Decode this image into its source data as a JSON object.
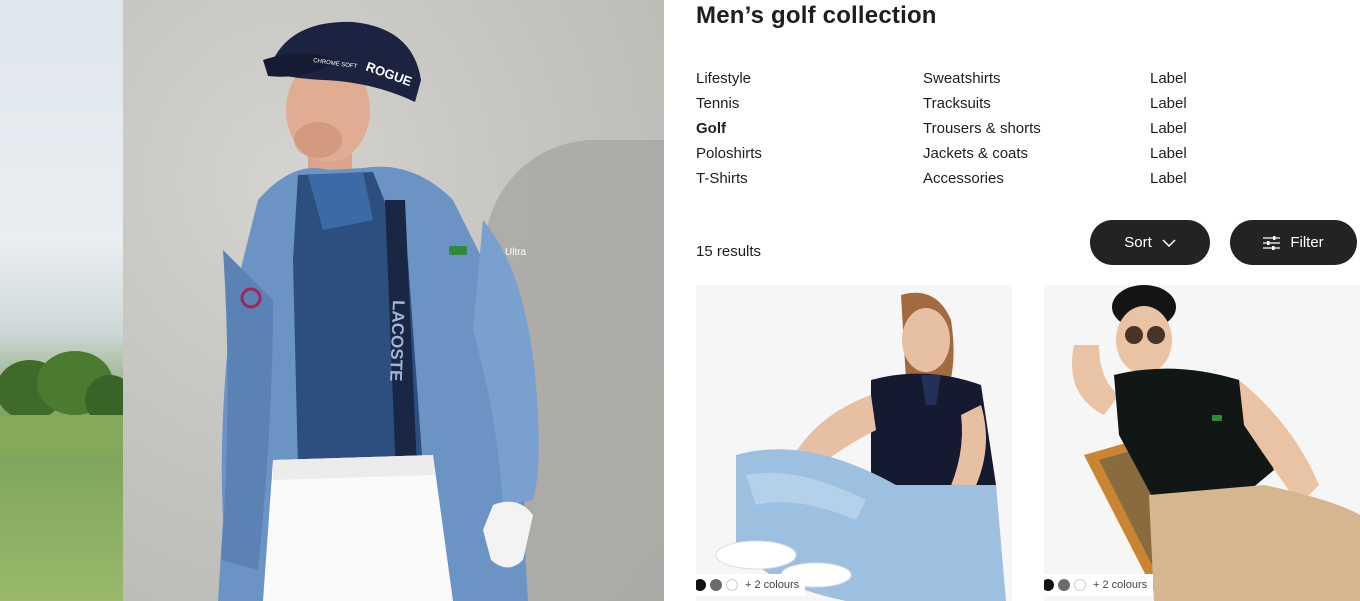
{
  "page": {
    "title": "Men’s golf collection"
  },
  "categories": {
    "column1": [
      "Lifestyle",
      "Tennis",
      "Golf",
      "Poloshirts",
      "T-Shirts"
    ],
    "column2": [
      "Sweatshirts",
      "Tracksuits",
      "Trousers & shorts",
      "Jackets & coats",
      "Accessories"
    ],
    "column3": [
      "Label",
      "Label",
      "Label",
      "Label",
      "Label"
    ],
    "active": "Golf"
  },
  "results": {
    "count_label": "15 results"
  },
  "toolbar": {
    "sort_label": "Sort",
    "filter_label": "Filter"
  },
  "hero": {
    "cap_text": "ROGUE",
    "cap_brand": "CHROME SOFT",
    "jacket_text": "LACOSTE",
    "sleeve_text": "Ultra"
  },
  "products": [
    {
      "swatch_colors": [
        "#111111",
        "#6b6b6b",
        "#ffffff"
      ],
      "more_colours": "+ 2 colours"
    },
    {
      "swatch_colors": [
        "#111111",
        "#6b6b6b",
        "#ffffff"
      ],
      "more_colours": "+ 2 colours"
    }
  ],
  "colors": {
    "button_bg": "#232323",
    "text": "#1e1e1e",
    "jacket": "#6b93c4",
    "polo_navy": "#15203a"
  }
}
